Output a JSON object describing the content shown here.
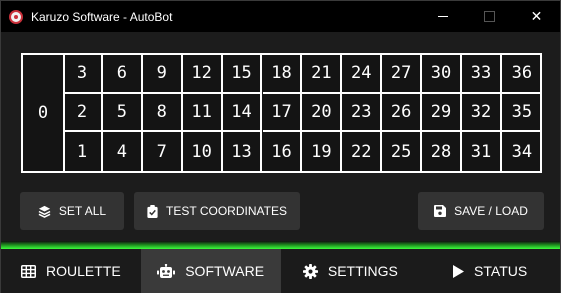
{
  "window": {
    "title": "Karuzo Software - AutoBot",
    "controls": {
      "minimize": "—",
      "close": "✕"
    }
  },
  "roulette": {
    "zero": "0",
    "rows": [
      [
        "3",
        "6",
        "9",
        "12",
        "15",
        "18",
        "21",
        "24",
        "27",
        "30",
        "33",
        "36"
      ],
      [
        "2",
        "5",
        "8",
        "11",
        "14",
        "17",
        "20",
        "23",
        "26",
        "29",
        "32",
        "35"
      ],
      [
        "1",
        "4",
        "7",
        "10",
        "13",
        "16",
        "19",
        "22",
        "25",
        "28",
        "31",
        "34"
      ]
    ]
  },
  "actions": {
    "set_all": "SET ALL",
    "test_coordinates": "TEST COORDINATES",
    "save_load": "SAVE / LOAD"
  },
  "tabs": [
    {
      "label": "ROULETTE",
      "icon": "grid-icon"
    },
    {
      "label": "SOFTWARE",
      "icon": "robot-icon",
      "active": true
    },
    {
      "label": "SETTINGS",
      "icon": "gear-icon"
    },
    {
      "label": "STATUS",
      "icon": "play-icon"
    }
  ],
  "colors": {
    "accent_glow": "#3cff3c",
    "background": "#1c1c1c",
    "button": "#333333",
    "active_tab": "#3a3a3a"
  }
}
